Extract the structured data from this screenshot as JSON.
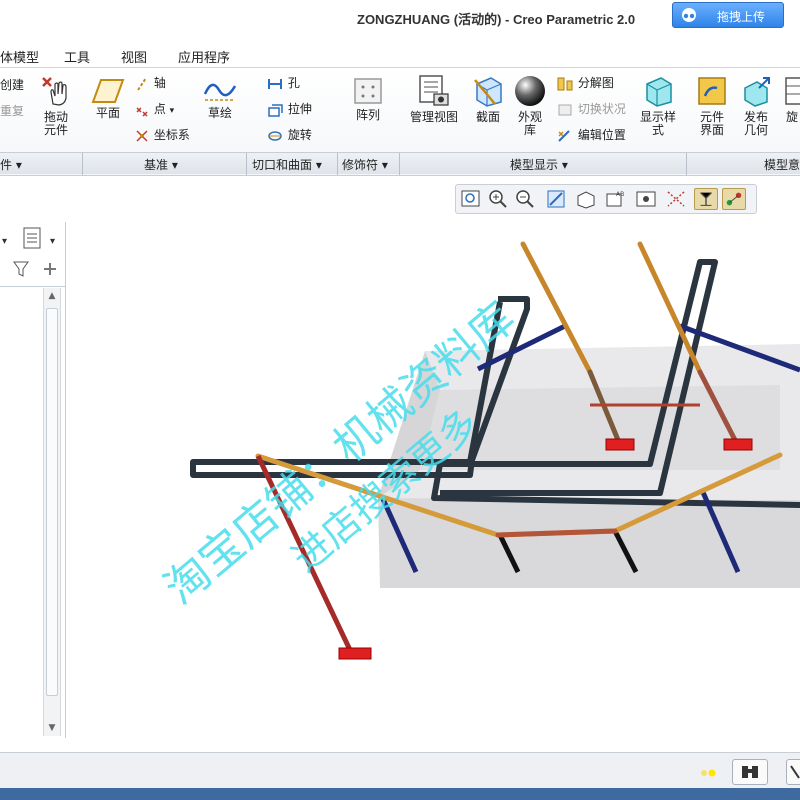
{
  "window": {
    "title": "ZONGZHUANG (活动的) - Creo Parametric 2.0",
    "upload_button": "拖拽上传"
  },
  "menu": {
    "tabs": [
      "体模型",
      "工具",
      "视图",
      "应用程序"
    ]
  },
  "ribbon": {
    "left_partial": {
      "create": "创建",
      "regen": "重复"
    },
    "drag": "拖动\n元件",
    "plane": "平面",
    "axis": "轴",
    "point": "点",
    "csys": "坐标系",
    "sketch": "草绘",
    "hole": "孔",
    "extrude": "拉伸",
    "revolve": "旋转",
    "pattern": "阵列",
    "manage_views": "管理视图",
    "section": "截面",
    "appearance_lib": "外观\n库",
    "explode": "分解图",
    "toggle_status": "切换状况",
    "edit_position": "编辑位置",
    "display_style": "显示样\n式",
    "component_interface": "元件\n界面",
    "publish_geometry": "发布\n几何",
    "rotate_partial": "旋"
  },
  "groups": {
    "left_partial": "件 ▾",
    "datum": "基准 ▾",
    "cuts_surfaces": "切口和曲面 ▾",
    "modifiers": "修饰符 ▾",
    "model_display": "模型显示 ▾",
    "model_intent_partial": "模型意"
  },
  "watermark": {
    "line1": "淘宝店铺：机械资料库",
    "line2": "进店搜索更多"
  },
  "colors": {
    "accent_blue": "#2f83e8",
    "watermark": "#46dceb",
    "pipe_black": "#2a3540",
    "pipe_orange": "#c8862a",
    "pipe_red": "#a52a2a",
    "pipe_navy": "#1e2a78",
    "base_red": "#e02020",
    "box_gray": "#cfcfd2"
  }
}
